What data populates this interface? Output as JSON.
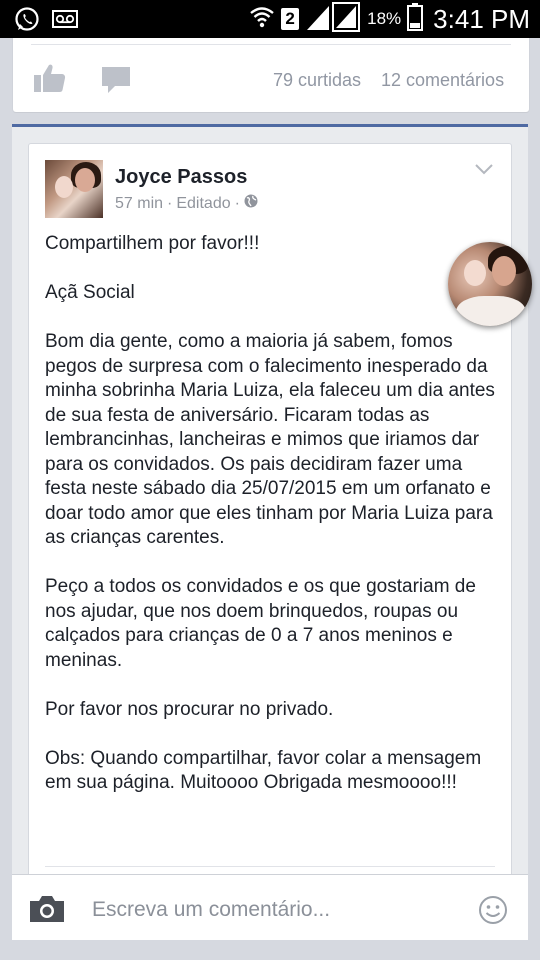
{
  "status_bar": {
    "sim_number": "2",
    "battery_percent": "18%",
    "time": "3:41 PM"
  },
  "previous_post": {
    "likes_text": "79 curtidas",
    "comments_text": "12 comentários"
  },
  "post": {
    "author": "Joyce Passos",
    "time": "57 min",
    "separator": "·",
    "edited": "Editado",
    "paragraphs": [
      "Compartilhem por favor!!!",
      "Açã Social",
      "Bom dia gente, como a maioria já sabem, fomos pegos de surpresa com o falecimento inesperado da minha sobrinha Maria Luiza, ela faleceu um dia antes de sua festa de aniversário. Ficaram todas as lembrancinhas, lancheiras e mimos que iriamos dar para os convidados. Os pais decidiram fazer uma festa neste sábado dia 25/07/2015 em um orfanato e doar todo amor que eles tinham por Maria Luiza para as crianças carentes.",
      "Peço a todos os convidados e os que gostariam de nos ajudar, que nos doem brinquedos, roupas ou calçados para crianças de 0 a 7 anos meninos e meninas.",
      "Por favor nos procurar no privado.",
      "Obs: Quando compartilhar, favor colar a mensagem em sua página. Muitoooo Obrigada mesmoooo!!!"
    ]
  },
  "comment_bar": {
    "placeholder": "Escreva um comentário..."
  },
  "icons": {
    "whatsapp": "whatsapp-icon",
    "voicemail": "voicemail-icon",
    "wifi": "wifi-icon",
    "signal": "signal-icon",
    "battery": "battery-icon",
    "like": "like-icon",
    "comment": "comment-icon",
    "globe": "globe-icon",
    "chevron": "chevron-down-icon",
    "camera": "camera-icon",
    "emoji": "emoji-icon"
  },
  "colors": {
    "accent": "#4e69a2",
    "text": "#1d2129",
    "muted": "#90949c",
    "background": "#e9ebee"
  }
}
